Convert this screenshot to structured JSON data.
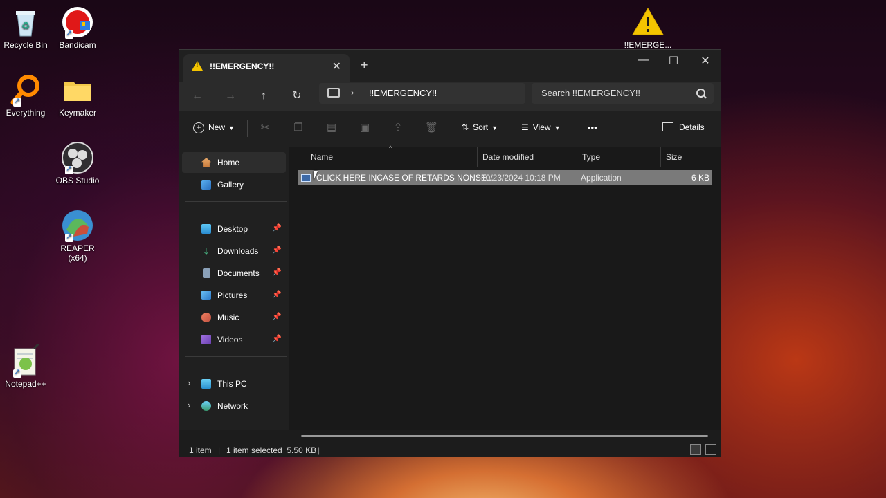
{
  "desktop": {
    "icons": [
      {
        "label": "Recycle Bin"
      },
      {
        "label": "Bandicam"
      },
      {
        "label": "Everything"
      },
      {
        "label": "Keymaker"
      },
      {
        "label": "OBS Studio"
      },
      {
        "label": "REAPER (x64)"
      },
      {
        "label": "Notepad++"
      },
      {
        "label": "!!EMERGE..."
      }
    ]
  },
  "window": {
    "tab_title": "!!EMERGENCY!!",
    "tab_close": "✕",
    "new_tab": "+",
    "minimize": "—",
    "maximize": "☐",
    "close": "✕",
    "nav": {
      "back": "←",
      "forward": "→",
      "up": "↑",
      "refresh": "↻"
    },
    "address": {
      "chevron": "›",
      "path": "!!EMERGENCY!!"
    },
    "search": {
      "placeholder": "Search !!EMERGENCY!!"
    },
    "toolbar": {
      "new_label": "New",
      "sort_label": "Sort",
      "view_label": "View",
      "more_label": "•••",
      "details_label": "Details"
    },
    "sidebar": {
      "items": [
        {
          "label": "Home"
        },
        {
          "label": "Gallery"
        },
        {
          "label": "Desktop"
        },
        {
          "label": "Downloads"
        },
        {
          "label": "Documents"
        },
        {
          "label": "Pictures"
        },
        {
          "label": "Music"
        },
        {
          "label": "Videos"
        },
        {
          "label": "This PC"
        },
        {
          "label": "Network"
        }
      ]
    },
    "columns": {
      "name": "Name",
      "date": "Date modified",
      "type": "Type",
      "size": "Size"
    },
    "files": [
      {
        "name": "CLICK HERE INCASE OF RETARDS NONSE...",
        "date": "10/23/2024 10:18 PM",
        "type": "Application",
        "size": "6 KB"
      }
    ],
    "status": {
      "count": "1 item",
      "selected": "1 item selected  5.50 KB"
    }
  },
  "colors": {
    "accent": "#f4c400",
    "window_bg": "#1c1c1c",
    "selected_row": "#7a7a7a"
  }
}
